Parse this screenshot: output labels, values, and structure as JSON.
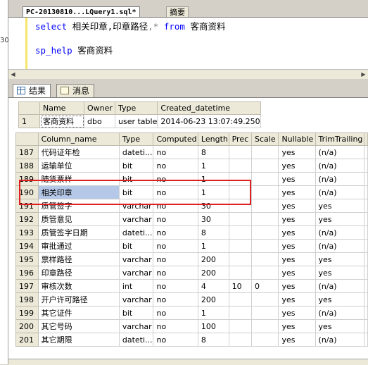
{
  "left_gutter_number": "30",
  "tabs": [
    {
      "label": "PC-20130810...LQuery1.sql*"
    },
    {
      "label": "摘要"
    }
  ],
  "query": {
    "line1": {
      "kw": "select",
      "cols": "相关印章,印章路径",
      "star": "*",
      "from": "from",
      "table": "客商资料"
    },
    "line2": {
      "proc": "sp_help",
      "arg": "客商资料"
    }
  },
  "result_tabs": [
    {
      "label": "结果"
    },
    {
      "label": "消息"
    }
  ],
  "top_table": {
    "headers": [
      "Name",
      "Owner",
      "Type",
      "Created_datetime"
    ],
    "rows": [
      {
        "num": "1",
        "cells": [
          "客商资料",
          "dbo",
          "user table",
          "2014-06-23 13:07:49.250"
        ]
      }
    ]
  },
  "columns_table": {
    "headers": [
      "Column_name",
      "Type",
      "Computed",
      "Length",
      "Prec",
      "Scale",
      "Nullable",
      "TrimTrailing"
    ],
    "rows": [
      {
        "num": "187",
        "cells": [
          "代码证年检",
          "dateti...",
          "no",
          "8",
          "",
          "",
          "yes",
          "(n/a)"
        ]
      },
      {
        "num": "188",
        "cells": [
          "运输单位",
          "bit",
          "no",
          "1",
          "",
          "",
          "yes",
          "(n/a)"
        ]
      },
      {
        "num": "189",
        "cells": [
          "随货票样",
          "bit",
          "no",
          "1",
          "",
          "",
          "yes",
          "(n/a)"
        ]
      },
      {
        "num": "190",
        "cells": [
          "相关印章",
          "bit",
          "no",
          "1",
          "",
          "",
          "yes",
          "(n/a)"
        ],
        "selected": true
      },
      {
        "num": "191",
        "cells": [
          "质管签字",
          "varchar",
          "no",
          "30",
          "",
          "",
          "yes",
          "yes"
        ]
      },
      {
        "num": "192",
        "cells": [
          "质管意见",
          "varchar",
          "no",
          "30",
          "",
          "",
          "yes",
          "yes"
        ]
      },
      {
        "num": "193",
        "cells": [
          "质管签字日期",
          "dateti...",
          "no",
          "8",
          "",
          "",
          "yes",
          "(n/a)"
        ]
      },
      {
        "num": "194",
        "cells": [
          "审批通过",
          "bit",
          "no",
          "1",
          "",
          "",
          "yes",
          "(n/a)"
        ]
      },
      {
        "num": "195",
        "cells": [
          "票样路径",
          "varchar",
          "no",
          "200",
          "",
          "",
          "yes",
          "yes"
        ]
      },
      {
        "num": "196",
        "cells": [
          "印章路径",
          "varchar",
          "no",
          "200",
          "",
          "",
          "yes",
          "yes"
        ]
      },
      {
        "num": "197",
        "cells": [
          "审核次数",
          "int",
          "no",
          "4",
          "10",
          "0",
          "yes",
          "(n/a)"
        ]
      },
      {
        "num": "198",
        "cells": [
          "开户许可路径",
          "varchar",
          "no",
          "200",
          "",
          "",
          "yes",
          "yes"
        ]
      },
      {
        "num": "199",
        "cells": [
          "其它证件",
          "bit",
          "no",
          "1",
          "",
          "",
          "yes",
          "(n/a)"
        ]
      },
      {
        "num": "200",
        "cells": [
          "其它号码",
          "varchar",
          "no",
          "100",
          "",
          "",
          "yes",
          "yes"
        ]
      },
      {
        "num": "201",
        "cells": [
          "其它期限",
          "dateti...",
          "no",
          "8",
          "",
          "",
          "yes",
          "(n/a)"
        ]
      }
    ]
  }
}
